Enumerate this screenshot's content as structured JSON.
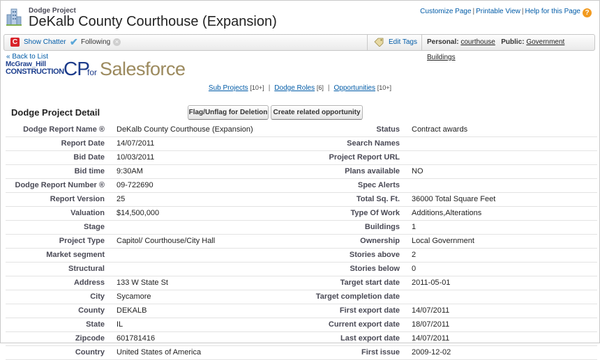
{
  "header": {
    "object_type": "Dodge Project",
    "title": "DeKalb County Courthouse (Expansion)",
    "links": [
      "Customize Page",
      "Printable View",
      "Help for this Page"
    ]
  },
  "toolbar": {
    "show_chatter": "Show Chatter",
    "following": "Following",
    "edit_tags": "Edit Tags",
    "personal_label": "Personal:",
    "personal_tag": "courthouse",
    "public_label": "Public:",
    "public_tag": "Government Buildings"
  },
  "nav": {
    "back": "« Back to List"
  },
  "logo": {
    "mh_line1": "McGraw_Hill",
    "mh_line2": "CONSTRUCTION",
    "cp": "CP",
    "for": "for",
    "salesforce": "Salesforce"
  },
  "related": [
    {
      "label": "Sub Projects",
      "count": "[10+]"
    },
    {
      "label": "Dodge Roles",
      "count": "[6]"
    },
    {
      "label": "Opportunities",
      "count": "[10+]"
    }
  ],
  "section": {
    "title": "Dodge Project Detail",
    "btn_flag": "Flag/Unflag for Deletion",
    "btn_opportunity": "Create related opportunity"
  },
  "fields": [
    {
      "l1": "Dodge Report Name ®",
      "v1": "DeKalb County Courthouse (Expansion)",
      "l2": "Status",
      "v2": "Contract awards"
    },
    {
      "l1": "Report Date",
      "v1": "14/07/2011",
      "l2": "Search Names",
      "v2": ""
    },
    {
      "l1": "Bid Date",
      "v1": "10/03/2011",
      "l2": "Project Report URL",
      "v2": ""
    },
    {
      "l1": "Bid time",
      "v1": "9:30AM",
      "l2": "Plans available",
      "v2": "NO"
    },
    {
      "l1": "Dodge Report Number ®",
      "v1": "09-722690",
      "l2": "Spec Alerts",
      "v2": ""
    },
    {
      "l1": "Report Version",
      "v1": "25",
      "l2": "Total Sq. Ft.",
      "v2": "36000 Total Square Feet"
    },
    {
      "l1": "Valuation",
      "v1": "$14,500,000",
      "l2": "Type Of Work",
      "v2": "Additions,Alterations"
    },
    {
      "l1": "Stage",
      "v1": "",
      "l2": "Buildings",
      "v2": "1"
    },
    {
      "l1": "Project Type",
      "v1": "Capitol/ Courthouse/City Hall",
      "l2": "Ownership",
      "v2": "Local Government"
    },
    {
      "l1": "Market segment",
      "v1": "",
      "l2": "Stories above",
      "v2": "2"
    },
    {
      "l1": "Structural",
      "v1": "",
      "l2": "Stories below",
      "v2": "0"
    },
    {
      "l1": "Address",
      "v1": "133 W State St",
      "l2": "Target start date",
      "v2": "2011-05-01"
    },
    {
      "l1": "City",
      "v1": "Sycamore",
      "l2": "Target completion date",
      "v2": ""
    },
    {
      "l1": "County",
      "v1": "DEKALB",
      "l2": "First export date",
      "v2": "14/07/2011"
    },
    {
      "l1": "State",
      "v1": "IL",
      "l2": "Current export date",
      "v2": "18/07/2011"
    },
    {
      "l1": "Zipcode",
      "v1": "601781416",
      "l2": "Last export date",
      "v2": "14/07/2011"
    },
    {
      "l1": "Country",
      "v1": "United States of America",
      "l2": "First issue",
      "v2": "2009-12-02"
    }
  ]
}
